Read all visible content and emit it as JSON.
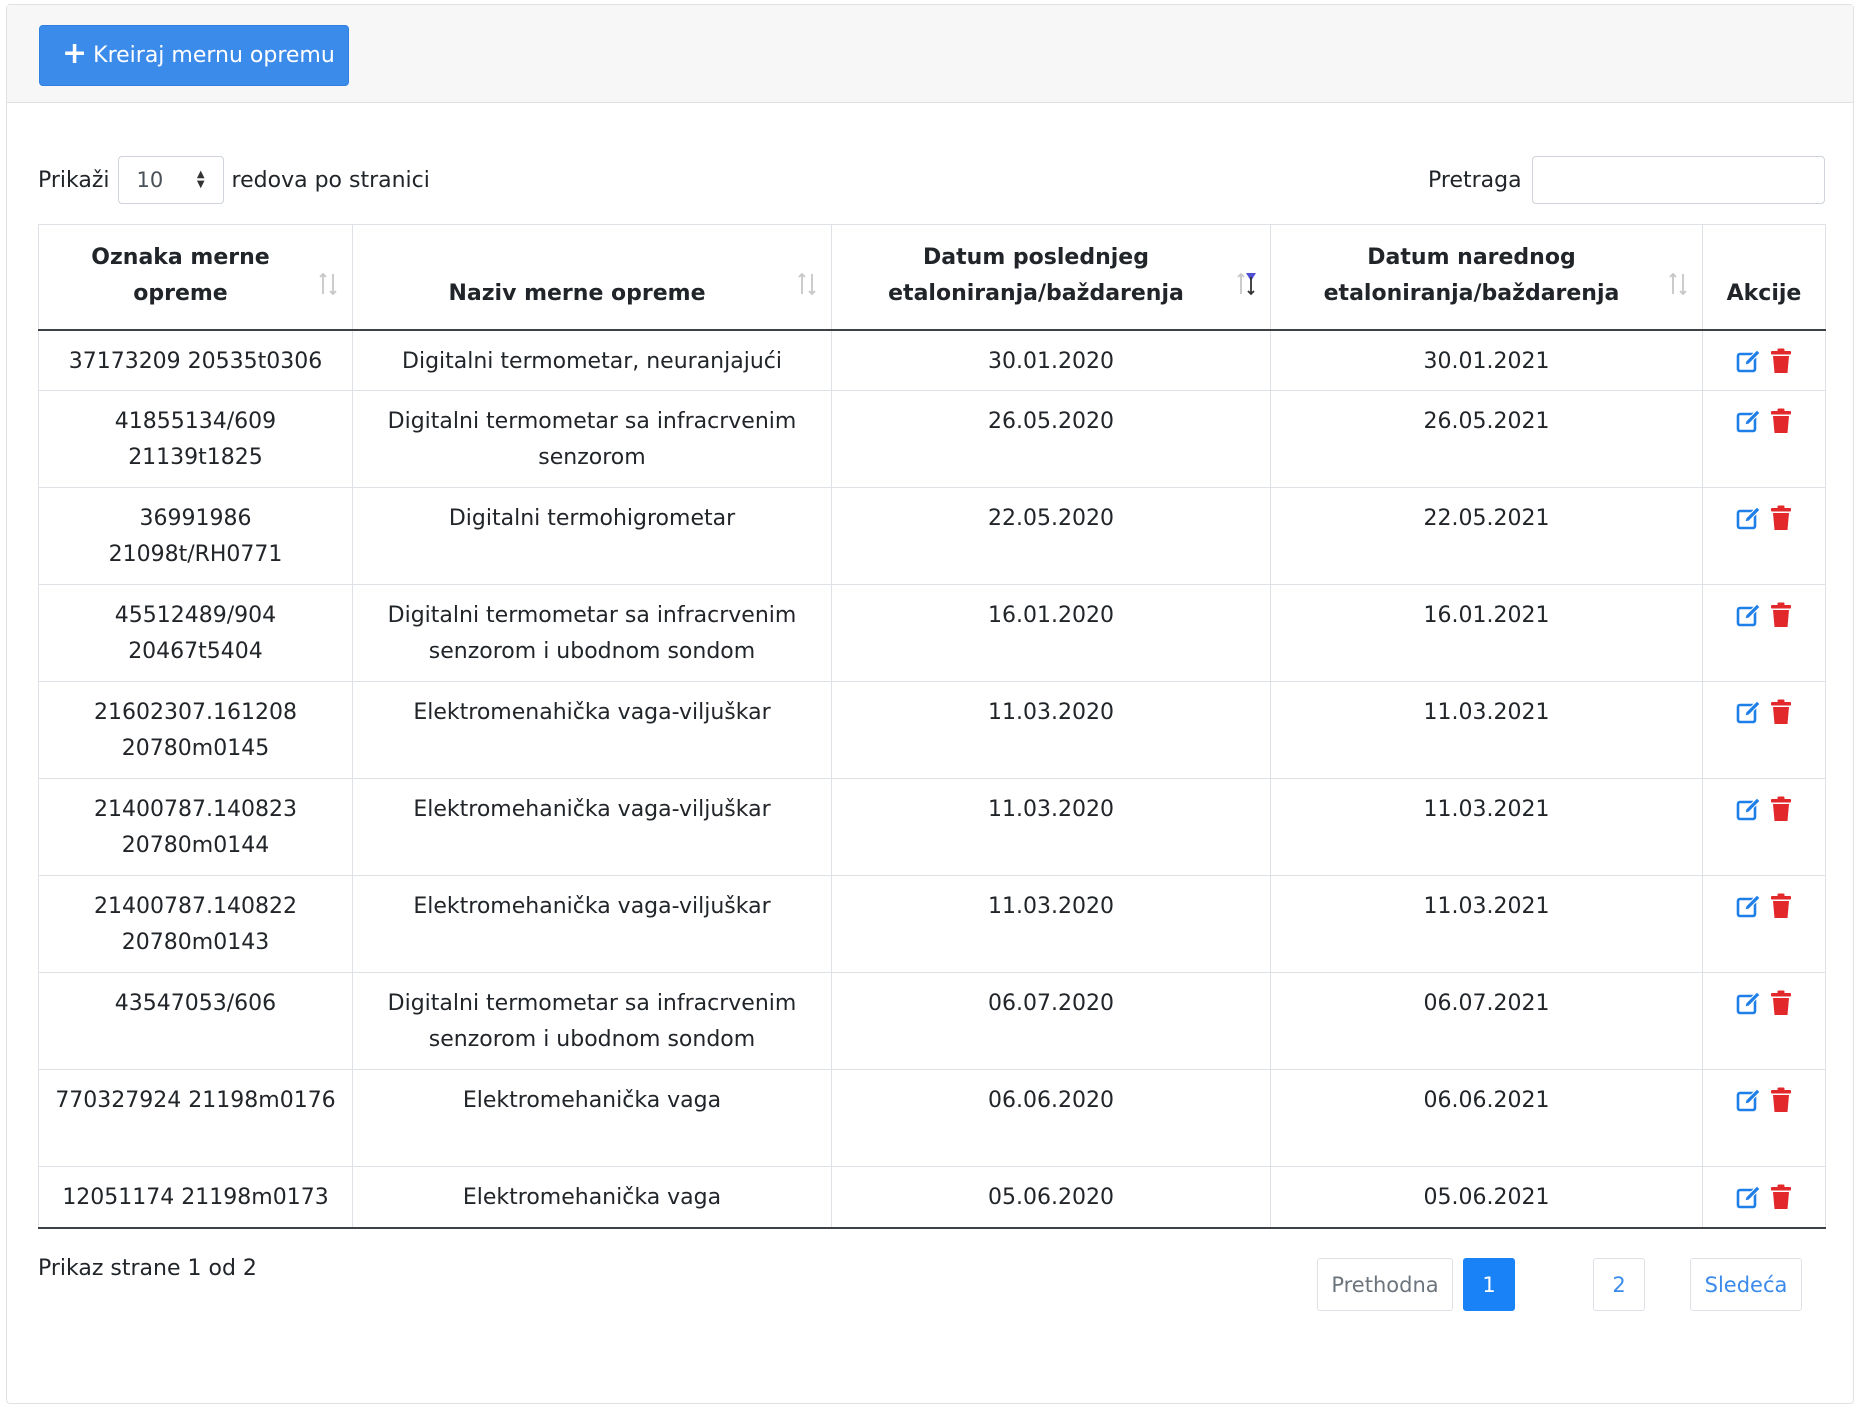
{
  "header": {
    "create_button_label": "Kreiraj mernu opremu"
  },
  "length": {
    "label_before": "Prikaži",
    "selected": "10",
    "label_after": "redova po stranici"
  },
  "search": {
    "label": "Pretraga",
    "value": ""
  },
  "table": {
    "columns": [
      "Oznaka merne opreme",
      "Naziv merne opreme",
      "Datum poslednjeg etaloniranja/baždarenja",
      "Datum narednog etaloniranja/baždarenja",
      "Akcije"
    ],
    "sorted_column": "Datum poslednjeg etaloniranja/baždarenja",
    "rows": [
      {
        "oznaka": "37173209 20535t0306",
        "naziv": "Digitalni termometar, neuranjajući",
        "poslednji": "30.01.2020",
        "naredni": "30.01.2021"
      },
      {
        "oznaka": "41855134/609 21139t1825",
        "naziv": "Digitalni termometar sa infracrvenim senzorom",
        "poslednji": "26.05.2020",
        "naredni": "26.05.2021"
      },
      {
        "oznaka": "36991986 21098t/RH0771",
        "naziv": "Digitalni termohigrometar",
        "poslednji": "22.05.2020",
        "naredni": "22.05.2021"
      },
      {
        "oznaka": "45512489/904 20467t5404",
        "naziv": "Digitalni termometar sa infracrvenim senzorom i ubodnom sondom",
        "poslednji": "16.01.2020",
        "naredni": "16.01.2021"
      },
      {
        "oznaka": "21602307.161208 20780m0145",
        "naziv": "Elektromenahička vaga-viljuškar",
        "poslednji": "11.03.2020",
        "naredni": "11.03.2021"
      },
      {
        "oznaka": "21400787.140823 20780m0144",
        "naziv": "Elektromehanička vaga-viljuškar",
        "poslednji": "11.03.2020",
        "naredni": "11.03.2021"
      },
      {
        "oznaka": "21400787.140822 20780m0143",
        "naziv": "Elektromehanička vaga-viljuškar",
        "poslednji": "11.03.2020",
        "naredni": "11.03.2021"
      },
      {
        "oznaka": "43547053/606",
        "naziv": "Digitalni termometar sa infracrvenim senzorom i ubodnom sondom",
        "poslednji": "06.07.2020",
        "naredni": "06.07.2021"
      },
      {
        "oznaka": "770327924 21198m0176",
        "naziv": "Elektromehanička vaga",
        "poslednji": "06.06.2020",
        "naredni": "06.06.2021"
      },
      {
        "oznaka": "12051174 21198m0173",
        "naziv": "Elektromehanička vaga",
        "poslednji": "05.06.2020",
        "naredni": "05.06.2021"
      }
    ]
  },
  "info": "Prikaz strane 1 od 2",
  "pagination": {
    "previous": "Prethodna",
    "pages": [
      "1",
      "2"
    ],
    "current": "1",
    "next": "Sledeća"
  },
  "colors": {
    "primary": "#3b8beb",
    "edit_icon": "#1f7fe8",
    "delete_icon": "#e3282c",
    "sort_active": "#4e4ed6"
  }
}
